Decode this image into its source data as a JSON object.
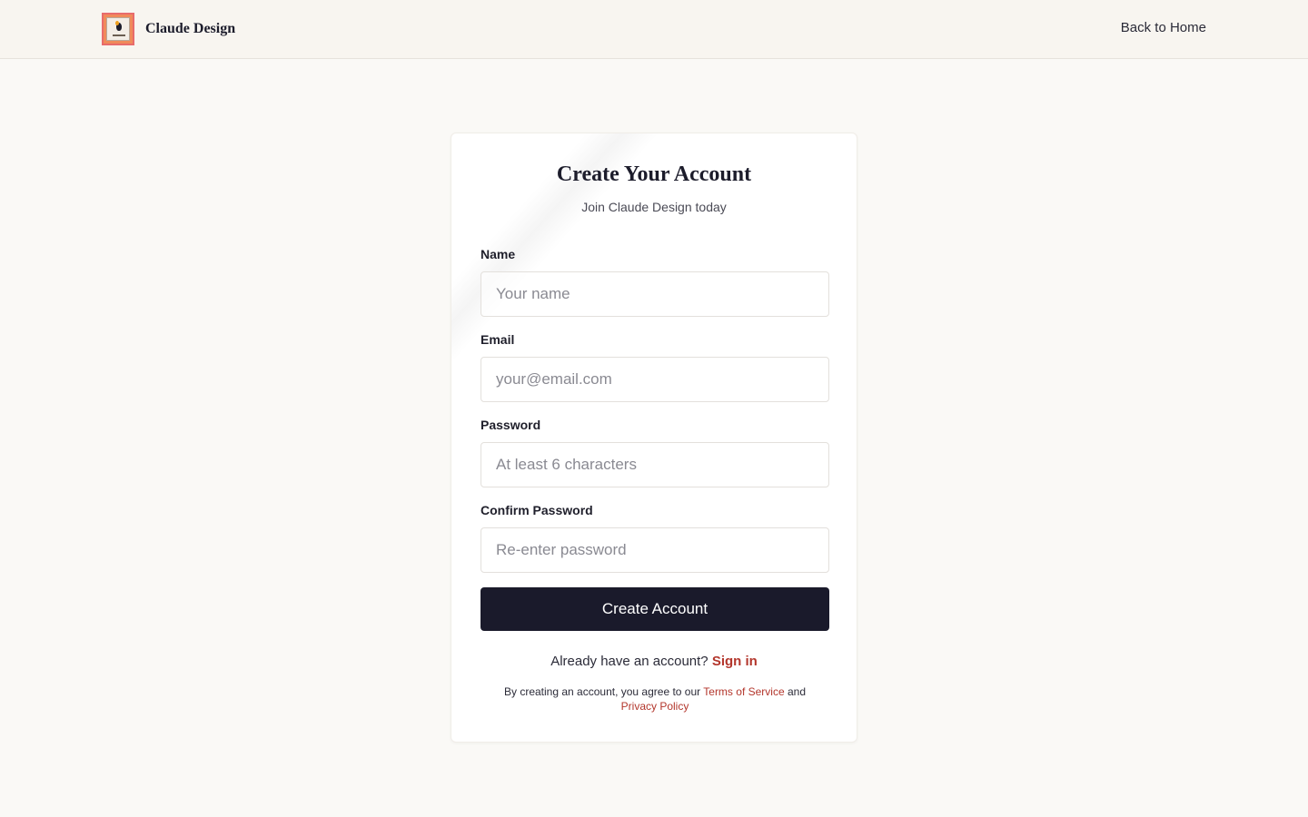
{
  "header": {
    "brand_name": "Claude Design",
    "logo_icon": "brand-logo-icon",
    "back_link": "Back to Home"
  },
  "form": {
    "title": "Create Your Account",
    "subtitle": "Join Claude Design today",
    "fields": [
      {
        "label": "Name",
        "placeholder": "Your name",
        "value": ""
      },
      {
        "label": "Email",
        "placeholder": "your@email.com",
        "value": ""
      },
      {
        "label": "Password",
        "placeholder": "At least 6 characters",
        "value": ""
      },
      {
        "label": "Confirm Password",
        "placeholder": "Re-enter password",
        "value": ""
      }
    ],
    "submit_label": "Create Account",
    "signin_prompt": "Already have an account?",
    "signin_link": "Sign in",
    "legal_prefix": "By creating an account, you agree to our",
    "terms_link": "Terms of Service",
    "legal_and": "and",
    "privacy_link": "Privacy Policy"
  },
  "colors": {
    "accent": "#b3362c",
    "primary_button": "#1a1a2b",
    "page_background": "#faf9f6"
  }
}
